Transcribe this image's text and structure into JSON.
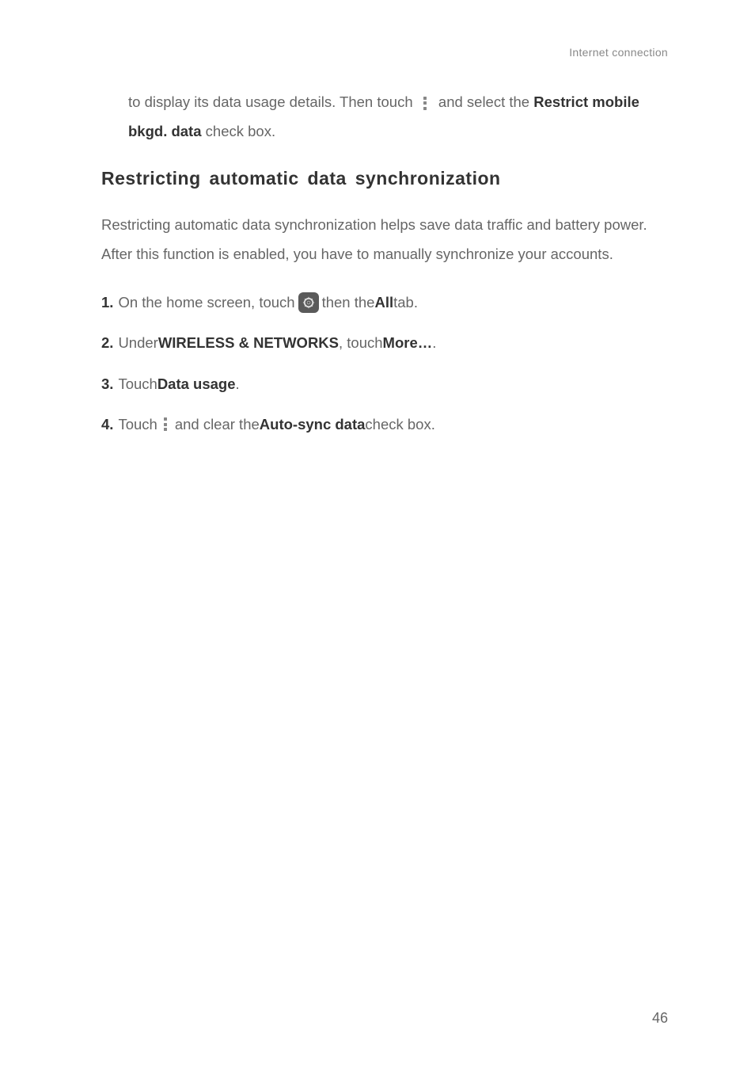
{
  "header": {
    "category": "Internet connection"
  },
  "intro_paragraph": {
    "part1": "to display its data usage details. Then touch ",
    "part2": " and select the ",
    "bold1": "Restrict mobile bkgd. data",
    "part3": " check box."
  },
  "section": {
    "heading": "Restricting automatic data synchronization",
    "description": "Restricting automatic data synchronization helps save data traffic and battery power. After this function is enabled, you have to manually synchronize your accounts."
  },
  "steps": [
    {
      "number": "1.",
      "part1": " On the home screen, touch ",
      "part2": " then the ",
      "bold1": "All",
      "part3": " tab."
    },
    {
      "number": "2.",
      "part1": " Under ",
      "bold1": "WIRELESS & NETWORKS",
      "part2": ", touch ",
      "bold2": "More…",
      "part3": "."
    },
    {
      "number": "3.",
      "part1": " Touch ",
      "bold1": "Data usage",
      "part2": "."
    },
    {
      "number": "4.",
      "part1": " Touch ",
      "part2": " and clear the ",
      "bold1": "Auto-sync data",
      "part3": " check box."
    }
  ],
  "page_number": "46"
}
